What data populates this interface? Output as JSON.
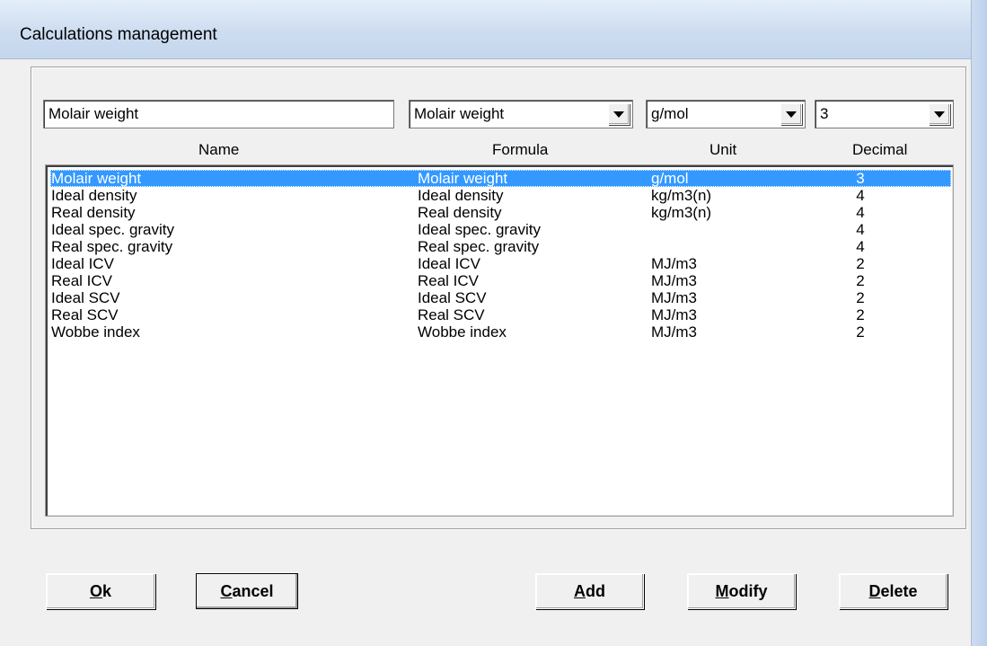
{
  "window": {
    "title": "Calculations management"
  },
  "editor": {
    "name_value": "Molair weight",
    "formula_value": "Molair weight",
    "unit_value": "g/mol",
    "decimal_value": "3"
  },
  "columns": {
    "name": "Name",
    "formula": "Formula",
    "unit": "Unit",
    "decimal": "Decimal"
  },
  "rows": [
    {
      "name": "Molair weight",
      "formula": "Molair weight",
      "unit": "g/mol",
      "decimal": "3",
      "selected": true
    },
    {
      "name": "Ideal density",
      "formula": "Ideal density",
      "unit": "kg/m3(n)",
      "decimal": "4"
    },
    {
      "name": "Real density",
      "formula": "Real density",
      "unit": "kg/m3(n)",
      "decimal": "4"
    },
    {
      "name": "Ideal spec. gravity",
      "formula": "Ideal spec. gravity",
      "unit": "",
      "decimal": "4"
    },
    {
      "name": "Real spec. gravity",
      "formula": "Real spec. gravity",
      "unit": "",
      "decimal": "4"
    },
    {
      "name": "Ideal ICV",
      "formula": "Ideal ICV",
      "unit": "MJ/m3",
      "decimal": "2"
    },
    {
      "name": "Real ICV",
      "formula": "Real ICV",
      "unit": "MJ/m3",
      "decimal": "2"
    },
    {
      "name": "Ideal SCV",
      "formula": "Ideal SCV",
      "unit": "MJ/m3",
      "decimal": "2"
    },
    {
      "name": "Real SCV",
      "formula": "Real SCV",
      "unit": "MJ/m3",
      "decimal": "2"
    },
    {
      "name": "Wobbe index",
      "formula": "Wobbe index",
      "unit": "MJ/m3",
      "decimal": "2"
    }
  ],
  "buttons": {
    "ok": {
      "mnemonic": "O",
      "rest": "k"
    },
    "cancel": {
      "mnemonic": "C",
      "rest": "ancel"
    },
    "add": {
      "mnemonic": "A",
      "rest": "dd"
    },
    "modify": {
      "mnemonic": "M",
      "rest": "odify"
    },
    "delete": {
      "mnemonic": "D",
      "rest": "elete"
    }
  },
  "colors": {
    "selection": "#3399ff",
    "titlebar": "#cddcf0"
  }
}
